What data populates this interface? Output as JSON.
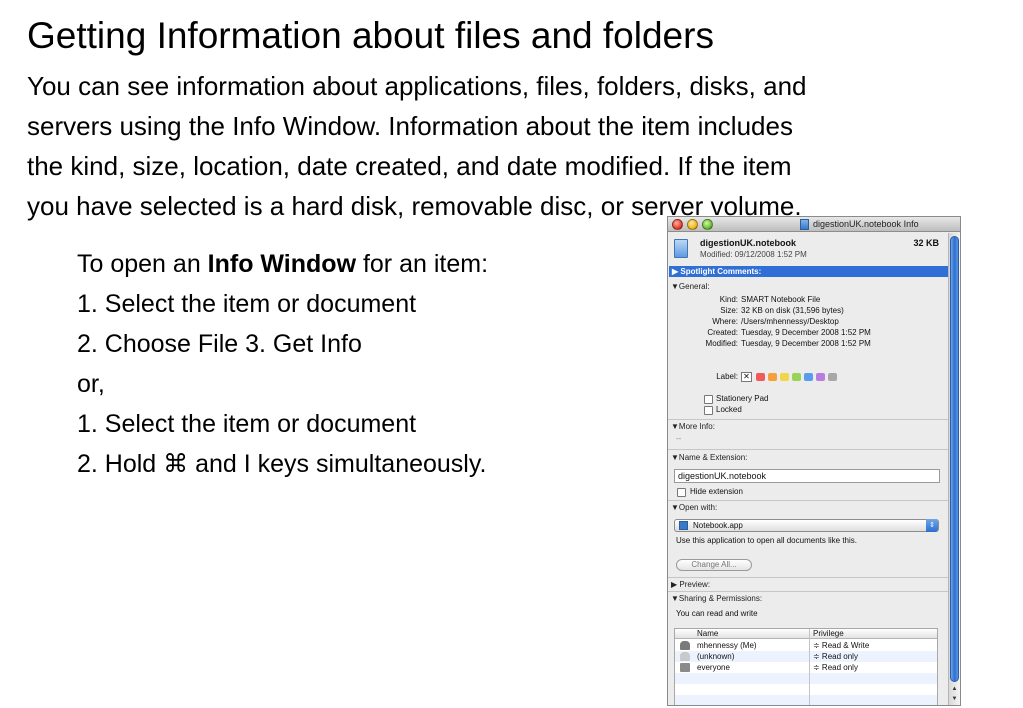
{
  "slide": {
    "title": "Getting Information about files and folders",
    "intro_lines": [
      "You can see information about applications, files, folders, disks, and",
      "servers using the Info Window. Information about the item includes",
      "the kind, size, location, date created, and date modified. If the item",
      "you have selected is a hard disk, removable disc, or server volume."
    ],
    "steps": {
      "line1_pre": "To open an ",
      "line1_bold": "Info Window",
      "line1_post": " for an item:",
      "line2": "1. Select the item or document",
      "line3": "2. Choose File 3. Get Info",
      "line4": "or,",
      "line5": "1. Select the item or document",
      "line6": "2. Hold ⌘ and I keys simultaneously."
    }
  },
  "info_window": {
    "title": "digestionUK.notebook Info",
    "icons": [
      "close-button",
      "minimize-button",
      "zoom-button",
      "document-icon",
      "lock-icon",
      "person-icon",
      "group-icon"
    ],
    "header": {
      "name": "digestionUK.notebook",
      "size": "32 KB",
      "modified": "Modified: 09/12/2008 1:52 PM"
    },
    "spotlight_label": "▶ Spotlight Comments:",
    "general": {
      "header": "▼General:",
      "rows": [
        {
          "key": "Kind:",
          "value": "SMART Notebook File"
        },
        {
          "key": "Size:",
          "value": "32 KB on disk (31,596 bytes)"
        },
        {
          "key": "Where:",
          "value": "/Users/mhennessy/Desktop"
        },
        {
          "key": "Created:",
          "value": "Tuesday, 9 December 2008 1:52 PM"
        },
        {
          "key": "Modified:",
          "value": "Tuesday, 9 December 2008 1:52 PM"
        }
      ],
      "label_key": "Label:",
      "label_none": "✕",
      "label_colors": [
        "#ef5a5a",
        "#f5a03c",
        "#f1d64a",
        "#9ad35a",
        "#5a9bef",
        "#b77ee0",
        "#a8a8a8"
      ],
      "stationery_pad": "Stationery Pad",
      "locked": "Locked"
    },
    "more_info": {
      "header": "▼More Info:",
      "value": "--"
    },
    "name_extension": {
      "header": "▼Name & Extension:",
      "value": "digestionUK.notebook",
      "hide_extension": "Hide extension"
    },
    "open_with": {
      "header": "▼Open with:",
      "app": "Notebook.app",
      "helper": "Use this application to open all documents like this.",
      "change_all": "Change All..."
    },
    "preview_header": "▶ Preview:",
    "sharing": {
      "header": "▼Sharing & Permissions:",
      "summary": "You can read and write",
      "col_name": "Name",
      "col_privilege": "Privilege",
      "rows": [
        {
          "name": "mhennessy (Me)",
          "privilege": "≑ Read & Write",
          "icon": "person-icon"
        },
        {
          "name": "(unknown)",
          "privilege": "≑ Read only",
          "icon": "person-icon"
        },
        {
          "name": "everyone",
          "privilege": "≑ Read only",
          "icon": "group-icon"
        }
      ]
    },
    "bottom": {
      "add": "+",
      "remove": "−",
      "action": "⚙▾"
    }
  }
}
